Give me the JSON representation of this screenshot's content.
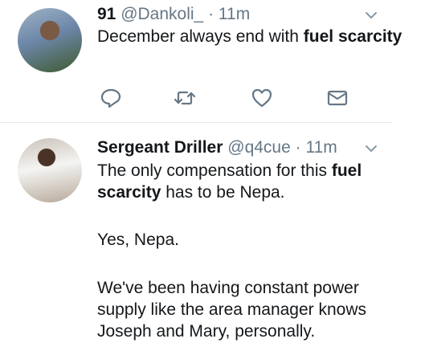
{
  "tweet1": {
    "name": "91",
    "handle": "@Dankoli_",
    "separator": "·",
    "time": "11m",
    "text_part1": "December always end with ",
    "text_bold": "fuel scarcity"
  },
  "tweet2": {
    "name": "Sergeant Driller",
    "handle": "@q4cue",
    "separator": "·",
    "time": "11m",
    "p1_part1": "The only compensation for this ",
    "p1_bold1": "fuel",
    "p1_bold2": "scarcity",
    "p1_part2": " has to be Nepa.",
    "p2": "Yes, Nepa.",
    "p3": "We've been having constant power supply like the area manager knows Joseph and Mary, personally."
  },
  "icons": {
    "reply": "reply-icon",
    "retweet": "retweet-icon",
    "like": "heart-icon",
    "dm": "envelope-icon",
    "more": "chevron-down-icon"
  },
  "colors": {
    "text": "#14171a",
    "secondary": "#657786",
    "divider": "#e1e8ed"
  }
}
